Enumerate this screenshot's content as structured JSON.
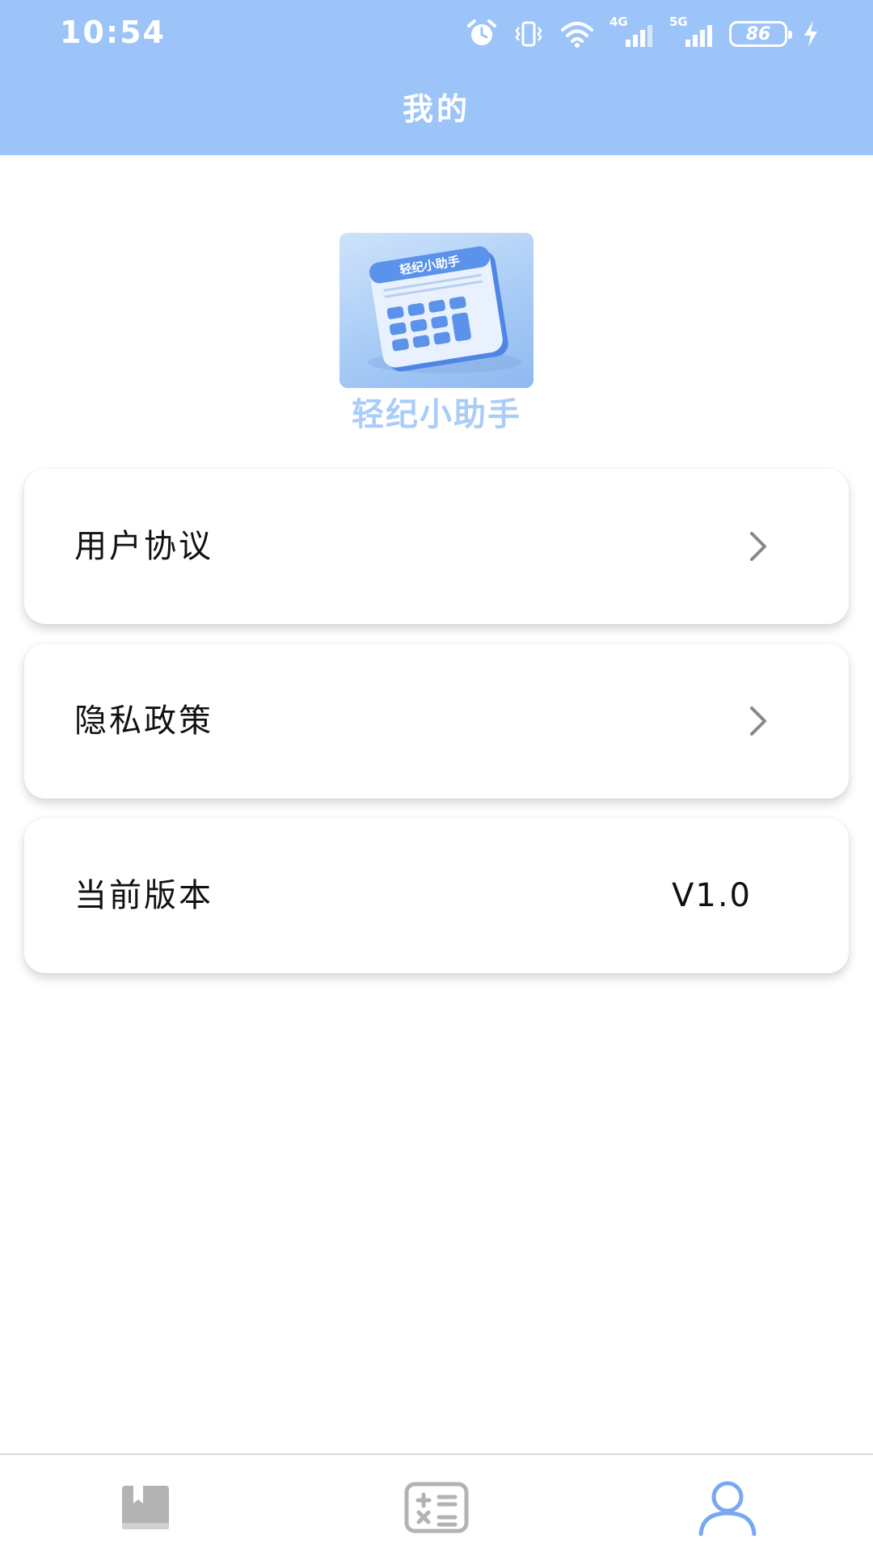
{
  "status_bar": {
    "time": "10:54",
    "network_4g": "4G",
    "network_5g": "5G",
    "battery": "86"
  },
  "header": {
    "title": "我的"
  },
  "app": {
    "name": "轻纪小助手",
    "logo_text": "轻纪小助手"
  },
  "menu": {
    "user_agreement": "用户协议",
    "privacy_policy": "隐私政策",
    "current_version_label": "当前版本",
    "current_version_value": "V1.0"
  },
  "tabbar": {
    "tabs": [
      {
        "icon": "book-icon",
        "active": false
      },
      {
        "icon": "calculator-icon",
        "active": false
      },
      {
        "icon": "user-icon",
        "active": true
      }
    ]
  },
  "colors": {
    "header_bg": "#9dc4f8",
    "accent": "#7aa8ee",
    "inactive_icon": "#b3b3b3"
  }
}
